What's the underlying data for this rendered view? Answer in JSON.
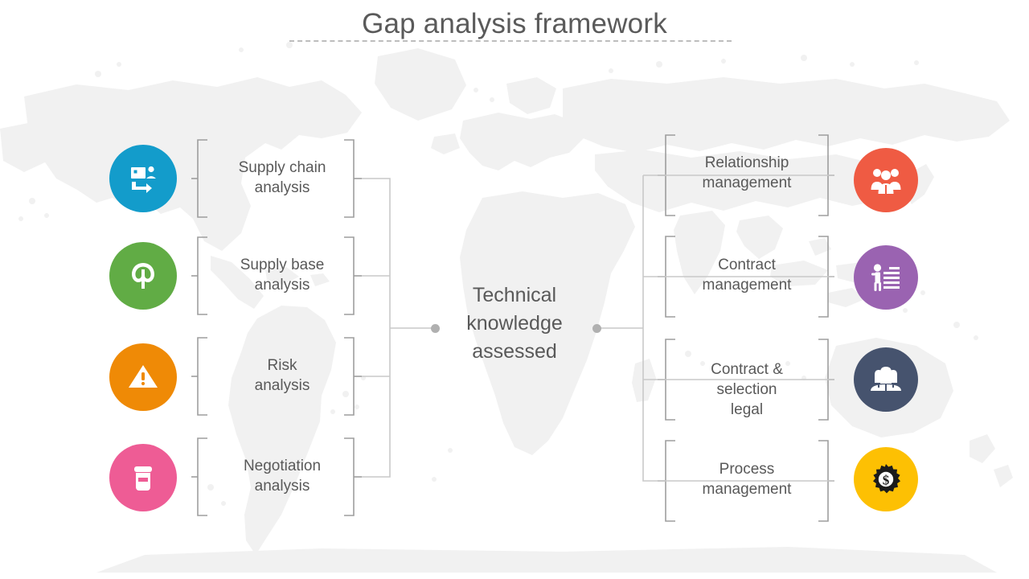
{
  "slide": {
    "title": "Gap analysis framework",
    "background": "world-map",
    "title_color": "#5a5a5a",
    "rule_color": "#bdbdbd"
  },
  "center": {
    "text_line1": "Technical",
    "text_line2": "knowledge",
    "text_line3": "assessed",
    "full_text": "Technical knowledge assessed",
    "dot_color": "#b0b0b0"
  },
  "left_items": [
    {
      "label_line1": "Supply chain",
      "label_line2": "analysis",
      "icon": "screen-share-user-icon",
      "color": "#139CCB"
    },
    {
      "label_line1": "Supply base",
      "label_line2": "analysis",
      "icon": "leaf-loop-icon",
      "color": "#61AC45"
    },
    {
      "label_line1": "Risk",
      "label_line2": "analysis",
      "icon": "warning-triangle-icon",
      "color": "#EF8A06"
    },
    {
      "label_line1": "Negotiation",
      "label_line2": "analysis",
      "icon": "jar-container-icon",
      "color": "#EE5C95"
    }
  ],
  "right_items": [
    {
      "label_line1": "Relationship",
      "label_line2": "management",
      "label_line3": "",
      "icon": "people-group-icon",
      "color": "#EF5B43"
    },
    {
      "label_line1": "Contract",
      "label_line2": "management",
      "label_line3": "",
      "icon": "person-document-icon",
      "color": "#9A63B1"
    },
    {
      "label_line1": "Contract &",
      "label_line2": "selection",
      "label_line3": "legal",
      "icon": "team-group-icon",
      "color": "#46536E"
    },
    {
      "label_line1": "Process",
      "label_line2": "management",
      "label_line3": "",
      "icon": "gear-dollar-icon",
      "color": "#FDC003"
    }
  ],
  "connector": {
    "line_color": "#c9c9c9",
    "bracket_color": "#9e9e9e"
  }
}
